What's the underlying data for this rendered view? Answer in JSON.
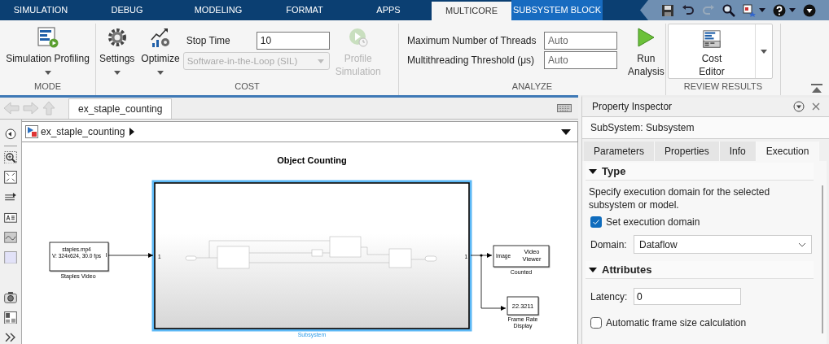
{
  "ribbon_tabs": [
    {
      "label": "SIMULATION",
      "selected": false,
      "contextual": false
    },
    {
      "label": "DEBUG",
      "selected": false,
      "contextual": false
    },
    {
      "label": "MODELING",
      "selected": false,
      "contextual": false
    },
    {
      "label": "FORMAT",
      "selected": false,
      "contextual": false
    },
    {
      "label": "APPS",
      "selected": false,
      "contextual": false
    },
    {
      "label": "MULTICORE",
      "selected": true,
      "contextual": false
    },
    {
      "label": "SUBSYSTEM BLOCK",
      "selected": false,
      "contextual": true
    }
  ],
  "ribbon": {
    "mode": {
      "label": "MODE",
      "button": "Simulation Profiling"
    },
    "cost": {
      "label": "COST",
      "settings": "Settings",
      "optimize": "Optimize",
      "stop_time_label": "Stop Time",
      "stop_time": "10",
      "target": {
        "value": "Software-in-the-Loop (SIL)",
        "disabled": true
      },
      "profile": {
        "label": "Profile Simulation",
        "disabled": true
      }
    },
    "analyze": {
      "label": "ANALYZE",
      "fields": [
        {
          "label": "Maximum Number of Threads",
          "placeholder": "Auto"
        },
        {
          "label": "Multithreading Threshold (μs)",
          "placeholder": "Auto"
        }
      ],
      "run": "Run Analysis"
    },
    "review": {
      "label": "REVIEW RESULTS",
      "button": "Cost Editor"
    }
  },
  "editor": {
    "model_tab": "ex_staple_counting",
    "breadcrumb": "ex_staple_counting",
    "diagram": {
      "title": "Object Counting",
      "blocks": [
        {
          "kind": "source",
          "lines": [
            "staples.mp4",
            "V: 324x624, 30.0 fps"
          ],
          "port": "I",
          "label": [
            "Staples Video"
          ]
        },
        {
          "kind": "subsystem",
          "in_port": "1",
          "out_port": "1",
          "label": [
            "Subsystem"
          ],
          "selected": true
        },
        {
          "kind": "viewer",
          "port": "Image",
          "lines": [
            "Video",
            "Viewer"
          ],
          "label": [
            "Counted"
          ]
        },
        {
          "kind": "display",
          "lines": [
            "22.3211"
          ],
          "label": [
            "Frame Rate",
            "Display"
          ]
        }
      ]
    }
  },
  "property_inspector": {
    "title": "Property Inspector",
    "subject": "SubSystem: Subsystem",
    "tabs": [
      {
        "label": "Parameters",
        "selected": false
      },
      {
        "label": "Properties",
        "selected": false
      },
      {
        "label": "Info",
        "selected": false
      },
      {
        "label": "Execution",
        "selected": true
      }
    ],
    "sections": [
      {
        "title": "Type",
        "expanded": true,
        "items": [
          {
            "kind": "text",
            "text": "Specify execution domain for the selected subsystem or model."
          },
          {
            "kind": "checkbox",
            "label": "Set execution domain",
            "checked": true
          },
          {
            "kind": "dropdown",
            "label": "Domain:",
            "value": "Dataflow"
          }
        ]
      },
      {
        "title": "Attributes",
        "expanded": true,
        "items": [
          {
            "kind": "field",
            "label": "Latency:",
            "value": "0"
          },
          {
            "kind": "checkbox",
            "label": "Automatic frame size calculation",
            "checked": false
          }
        ]
      }
    ]
  }
}
